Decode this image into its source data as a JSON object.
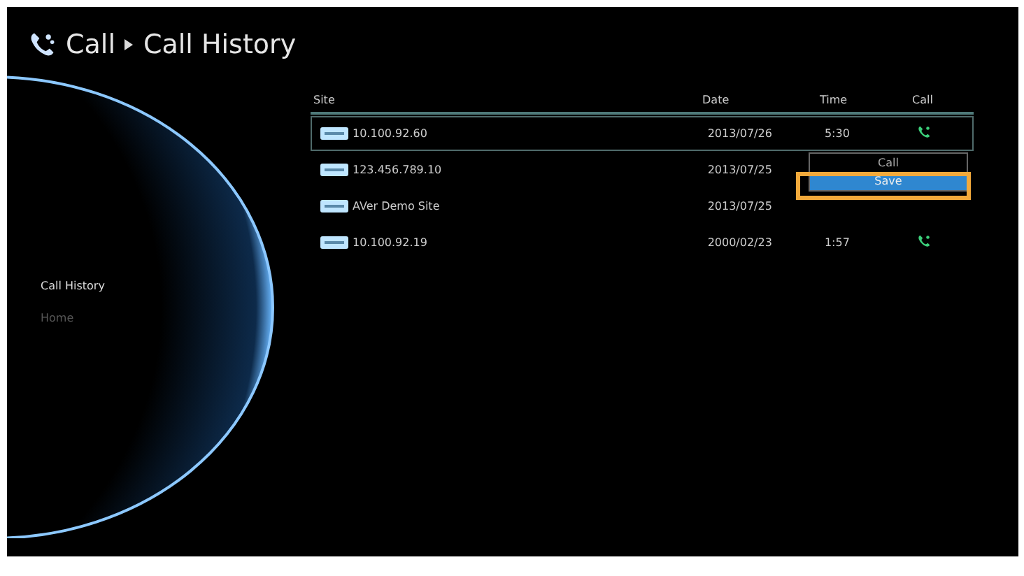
{
  "header": {
    "title": "Call",
    "subtitle": "Call History"
  },
  "sidebar": {
    "items": [
      {
        "label": "Call History",
        "selected": true
      },
      {
        "label": "Home",
        "selected": false
      }
    ]
  },
  "table": {
    "columns": [
      "Site",
      "Date",
      "Time",
      "Call"
    ],
    "rows": [
      {
        "site": "10.100.92.60",
        "date": "2013/07/26",
        "time": "5:30",
        "selected": true
      },
      {
        "site": "123.456.789.10",
        "date": "2013/07/25",
        "selected": false
      },
      {
        "site": "AVer Demo Site",
        "date": "2013/07/25",
        "selected": false
      },
      {
        "site": "10.100.92.19",
        "date": "2000/02/23",
        "time": "1:57",
        "selected": false
      }
    ]
  },
  "popup_menu": {
    "items": [
      {
        "label": "Call",
        "selected": false
      },
      {
        "label": "Save",
        "selected": true
      }
    ]
  }
}
